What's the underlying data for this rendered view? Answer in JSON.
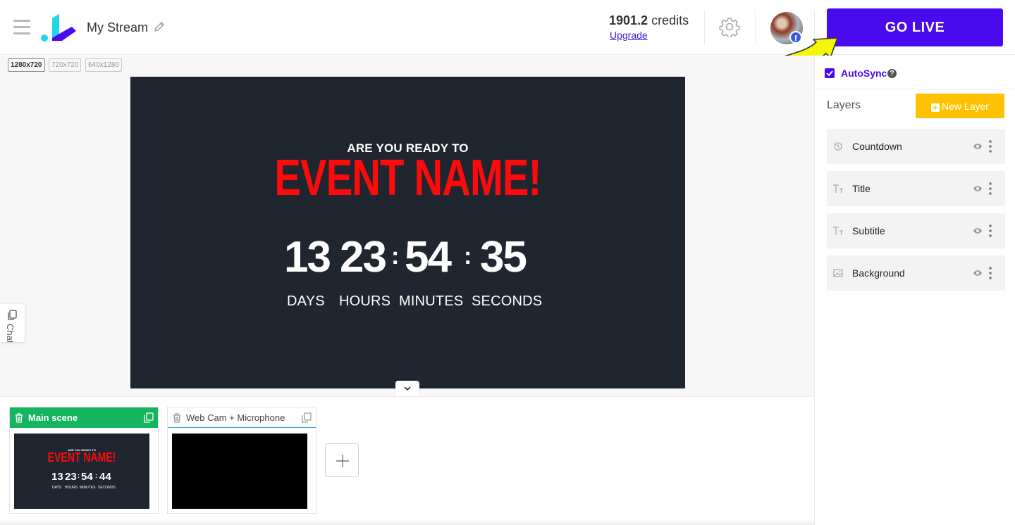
{
  "header": {
    "stream_name": "My Stream",
    "credits_value": "1901.2",
    "credits_unit": " credits",
    "upgrade_label": "Upgrade",
    "go_live_label": "GO LIVE",
    "avatar_badge": "f"
  },
  "resolutions": [
    {
      "label": "1280x720",
      "active": true
    },
    {
      "label": "720x720",
      "active": false
    },
    {
      "label": "640x1280",
      "active": false
    }
  ],
  "stage": {
    "subtitle": "ARE YOU READY TO",
    "title": "EVENT NAME!",
    "countdown": {
      "days": "13",
      "hours": "23",
      "minutes": "54",
      "seconds": "35",
      "sep": ":"
    },
    "labels": {
      "days": "DAYS",
      "hours": "HOURS",
      "minutes": "MINUTES",
      "seconds": "SECONDS"
    },
    "background_color": "#1f2630",
    "title_color": "#ff0a0a"
  },
  "chat_tab": {
    "label": "Chat"
  },
  "scenes": [
    {
      "name": "Main scene",
      "active": true,
      "thumb": {
        "subtitle": "ARE YOU READY TO",
        "title": "EVENT NAME!",
        "countdown": {
          "days": "13",
          "hours": "23",
          "minutes": "54",
          "seconds": "44",
          "sep": ":"
        },
        "labels": {
          "days": "DAYS",
          "hours": "HOURS",
          "minutes": "MINUTES",
          "seconds": "SECONDS"
        }
      }
    },
    {
      "name": "Web Cam + Microphone",
      "active": false
    }
  ],
  "right_panel": {
    "autosync_label": "AutoSync",
    "autosync_checked": true,
    "help_glyph": "?",
    "layers_title": "Layers",
    "new_layer_label": "New Layer",
    "new_layer_icon": "plus-square-icon",
    "layers": [
      {
        "name": "Countdown",
        "icon": "clock-icon"
      },
      {
        "name": "Title",
        "icon": "text-icon"
      },
      {
        "name": "Subtitle",
        "icon": "text-icon"
      },
      {
        "name": "Background",
        "icon": "image-icon"
      }
    ]
  },
  "colors": {
    "brand": "#4a0af0",
    "active_scene": "#15b45e",
    "new_layer": "#ffc200",
    "arrow": "#f5f50a"
  }
}
